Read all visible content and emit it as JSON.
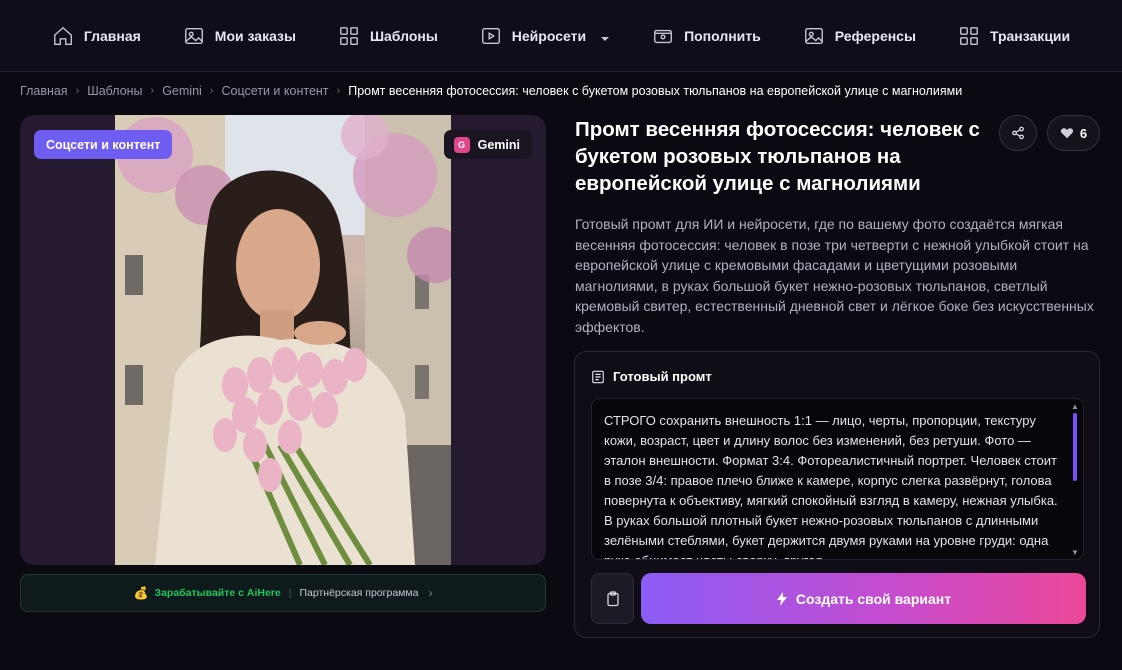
{
  "nav": {
    "items": [
      {
        "label": "Главная",
        "icon": "home-icon"
      },
      {
        "label": "Мои заказы",
        "icon": "image-icon"
      },
      {
        "label": "Шаблоны",
        "icon": "grid-icon"
      },
      {
        "label": "Нейросети",
        "icon": "play-icon",
        "dropdown": true
      },
      {
        "label": "Пополнить",
        "icon": "wallet-icon"
      },
      {
        "label": "Референсы",
        "icon": "image-icon"
      },
      {
        "label": "Транзакции",
        "icon": "grid-icon"
      }
    ]
  },
  "breadcrumb": {
    "items": [
      "Главная",
      "Шаблоны",
      "Gemini",
      "Соцсети и контент"
    ],
    "current": "Промт весенняя фотосессия: человек с букетом розовых тюльпанов на европейской улице с магнолиями"
  },
  "image": {
    "category_badge": "Соцсети и контент",
    "model_badge": "Gemini",
    "model_letter": "G"
  },
  "partner": {
    "earn_text": "Зарабатывайте с AiHere",
    "program_text": "Партнёрская программа"
  },
  "template": {
    "title": "Промт весенняя фотосессия: человек с букетом розовых тюльпанов на европейской улице с магнолиями",
    "likes": "6",
    "description": "Готовый промт для ИИ и нейросети, где по вашему фото создаётся мягкая весенняя фотосессия: человек в позе три четверти с нежной улыбкой стоит на европейской улице с кремовыми фасадами и цветущими розовыми магнолиями, в руках большой букет нежно-розовых тюльпанов, светлый кремовый свитер, естественный дневной свет и лёгкое боке без искусственных эффектов."
  },
  "prompt": {
    "heading": "Готовый промт",
    "text": "СТРОГО сохранить внешность 1:1 — лицо, черты, пропорции, текстуру кожи, возраст, цвет и длину волос без изменений, без ретуши. Фото — эталон внешности. Формат 3:4. Фотореалистичный портрет. Человек стоит в позе 3/4: правое плечо ближе к камере, корпус слегка развёрнут, голова повернута к объективу, мягкий спокойный взгляд в камеру, нежная улыбка. В руках большой плотный букет нежно-розовых тюльпанов с длинными зелёными стеблями, букет держится двумя руками на уровне груди: одна рука обнимает цветы сверху, другая",
    "create_label": "Создать свой вариант"
  },
  "colors": {
    "accent": "#6f5cf0",
    "gradient_start": "#8b5cf6",
    "gradient_end": "#ec4899",
    "partner_green": "#22c55e"
  }
}
